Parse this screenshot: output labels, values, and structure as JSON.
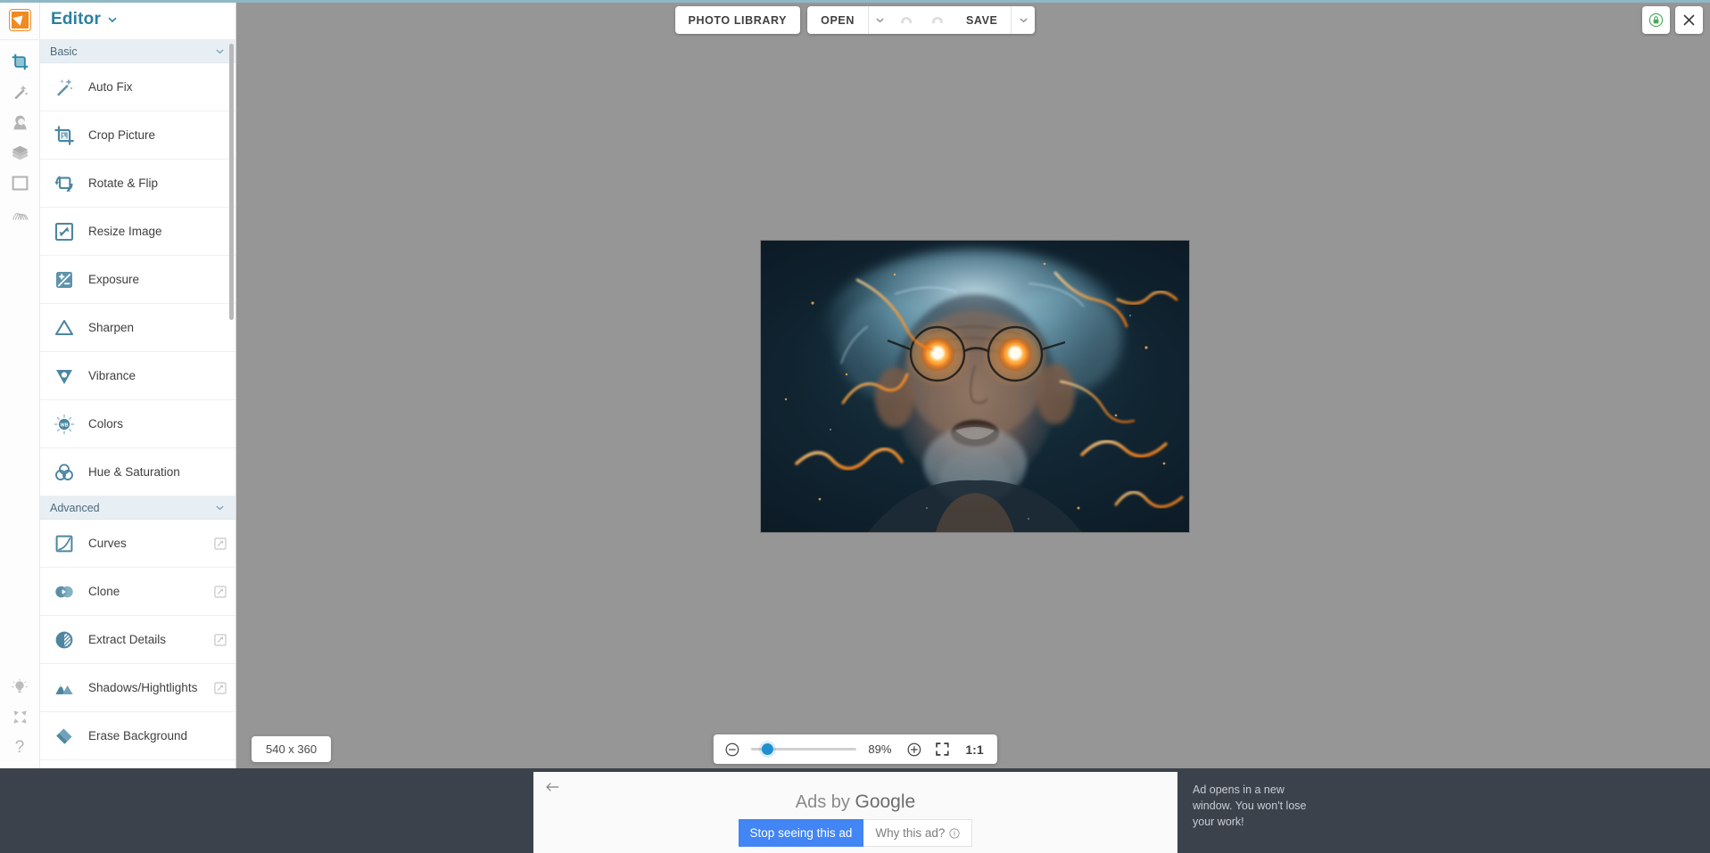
{
  "app": {
    "title": "Editor",
    "logo_icon": "editor-logo-icon",
    "title_caret_icon": "chevron-down-icon"
  },
  "toolbar": {
    "photo_library_label": "PHOTO LIBRARY",
    "open_label": "OPEN",
    "open_caret_icon": "chevron-down-icon",
    "undo_icon": "undo-icon",
    "redo_icon": "redo-icon",
    "save_label": "SAVE",
    "save_caret_icon": "chevron-down-icon",
    "lock_icon": "secure-lock-icon",
    "close_icon": "close-icon"
  },
  "rail": {
    "items": [
      {
        "name": "crop-tool",
        "icon": "crop-icon",
        "active": true
      },
      {
        "name": "magic-tool",
        "icon": "magic-wand-icon",
        "active": false
      },
      {
        "name": "portrait-tool",
        "icon": "portrait-retouch-icon",
        "active": false
      },
      {
        "name": "layers-tool",
        "icon": "layers-icon",
        "active": false
      },
      {
        "name": "frame-tool",
        "icon": "frame-icon",
        "active": false
      },
      {
        "name": "texture-tool",
        "icon": "texture-icon",
        "active": false
      }
    ],
    "bottom_items": [
      {
        "name": "tips",
        "icon": "lightbulb-icon"
      },
      {
        "name": "collapse",
        "icon": "collapse-arrows-icon"
      },
      {
        "name": "help",
        "icon": "question-mark-icon"
      }
    ]
  },
  "sidebar": {
    "groups": [
      {
        "label": "Basic",
        "caret_icon": "chevron-down-icon",
        "tools": [
          {
            "label": "Auto Fix",
            "icon": "magic-wand-icon",
            "premium": false
          },
          {
            "label": "Crop Picture",
            "icon": "crop-icon",
            "premium": false
          },
          {
            "label": "Rotate & Flip",
            "icon": "rotate-flip-icon",
            "premium": false
          },
          {
            "label": "Resize Image",
            "icon": "resize-icon",
            "premium": false
          },
          {
            "label": "Exposure",
            "icon": "exposure-icon",
            "premium": false
          },
          {
            "label": "Sharpen",
            "icon": "sharpen-icon",
            "premium": false
          },
          {
            "label": "Vibrance",
            "icon": "vibrance-icon",
            "premium": false
          },
          {
            "label": "Colors",
            "icon": "white-balance-icon",
            "premium": false
          },
          {
            "label": "Hue & Saturation",
            "icon": "hue-saturation-icon",
            "premium": false
          }
        ]
      },
      {
        "label": "Advanced",
        "caret_icon": "chevron-down-icon",
        "tools": [
          {
            "label": "Curves",
            "icon": "curves-icon",
            "premium": true
          },
          {
            "label": "Clone",
            "icon": "clone-stamp-icon",
            "premium": true
          },
          {
            "label": "Extract Details",
            "icon": "extract-details-icon",
            "premium": true
          },
          {
            "label": "Shadows/Hightlights",
            "icon": "shadows-highlights-icon",
            "premium": true
          },
          {
            "label": "Erase Background",
            "icon": "eraser-icon",
            "premium": false
          }
        ]
      }
    ]
  },
  "canvas": {
    "image_dimensions": "540 x 360",
    "image_alt": "portrait of an elderly man with glowing orange eyes and round glasses surrounded by electric energy"
  },
  "zoom_controls": {
    "zoom_out_icon": "zoom-out-icon",
    "zoom_in_icon": "zoom-in-icon",
    "fit_screen_icon": "fit-screen-icon",
    "level": "89%",
    "slider_value": 10,
    "actual_size_label": "1:1"
  },
  "ad": {
    "back_icon": "back-arrow-icon",
    "attribution_prefix": "Ads by ",
    "attribution_brand": "Google",
    "stop_label": "Stop seeing this ad",
    "why_label": "Why this ad?",
    "why_info_icon": "info-icon",
    "note": "Ad opens in a new window. You won't lose your work!"
  },
  "colors": {
    "accent_teal": "#2b7fa0",
    "accent_orange": "#f18a21",
    "slider_blue": "#1f8fd0",
    "ad_blue": "#4285f4",
    "canvas_gray": "#969696",
    "adbar_dark": "#3c424b"
  }
}
